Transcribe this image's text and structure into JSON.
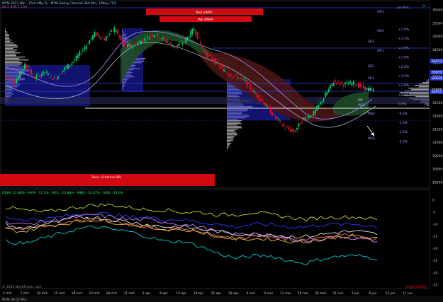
{
  "header": {
    "line1": "MYM 2022 Min - 15minMp % - MYM Swing Channel 360 Min, 1Mkey TFO",
    "line2": "48.2 47N 1 100"
  },
  "top_right_logo": "⟳",
  "brand_bottom_right": "NINJATRADER",
  "copyright": "© 2022 NinjaTrader, LLC",
  "tab_label": "MYM 06-22 Min",
  "colors": {
    "bg": "#000000",
    "up": "#00d26a",
    "down": "#e0132b",
    "red_banner": "#d10a12",
    "blue_level": "#2e3fd9",
    "profile_gray": "#9a9a9a",
    "profile_blue": "#1f22c8",
    "green_fill": "#1d4a24",
    "red_fill": "#4a1414",
    "sine": "#8a7fd8"
  },
  "banners": {
    "red_vwap": "Red VWAP",
    "wk_vwap": "Wk VWAP",
    "poc": "Pocs +Channel BO"
  },
  "level_labels": {
    "top_blue": "Jan POC",
    "mr3": "MR3",
    "mr2": "MR2",
    "mr1": "MR1",
    "sr3": "SR3",
    "sr2": "SR2",
    "sr1": "SR1",
    "pp": "PP",
    "mp": "MP",
    "ws1": "WS1",
    "ws2": "WS2",
    "ws3": "WS3"
  },
  "pct_labels": [
    "+1.0%",
    "+1.5%",
    "+1.5%",
    "+1.0%",
    "+2.0%",
    "+1.5%",
    "+1.0%",
    "+0.5%",
    "0.0%",
    "-0.5%",
    "-1.0%",
    "-1.5%",
    "-2.0%"
  ],
  "price_axis": [
    "36000",
    "35500",
    "35000",
    "34500",
    "34000",
    "33500",
    "33000",
    "32500",
    "32000",
    "31500",
    "31000",
    "30500",
    "30000",
    "29500"
  ],
  "price_tags": [
    {
      "label": "34073",
      "color": "#2e3fd9"
    },
    {
      "label": "33651",
      "color": "#2e3fd9"
    },
    {
      "label": "33424",
      "color": "#2e3fd9"
    },
    {
      "label": "32985",
      "color": "#1a1a1a"
    },
    {
      "label": "32917",
      "color": "#2e3fd9"
    }
  ],
  "indicator": {
    "title": "FSSM: 22.88% · MYM: -11.2% · MES: -15.88% · MNQ: -24.07% · M2K: -17.0%",
    "axis": [
      "0",
      "-5",
      "-10",
      "-15",
      "-20",
      "-25",
      "-30",
      "-35"
    ]
  },
  "time_axis": [
    "2 mrt",
    "7 mrt",
    "10 mrt",
    "15 mrt",
    "18 mrt",
    "23 mrt",
    "28 mrt",
    "31 mrt",
    "5 apr",
    "8 apr",
    "13 apr",
    "19 apr",
    "25 apr",
    "28 apr",
    "4 mei",
    "9 mei",
    "12 mei",
    "18 mei",
    "25 mei",
    "31 mei",
    "3 jun",
    "8 jun",
    "14 jun",
    "17 jun"
  ],
  "chart_data": [
    {
      "type": "line",
      "note_series": "price panel (MYM 15min, close approximated)",
      "ylim": [
        29500,
        36000
      ],
      "series": [
        {
          "values": [
            33500,
            33300,
            33900,
            33450,
            33650,
            33400,
            33800,
            34100,
            34600,
            35100,
            34900,
            35300,
            34600,
            34700,
            34900,
            35100,
            34850,
            34600,
            34800,
            35300,
            34400,
            34100,
            33700,
            33500,
            33350,
            32900,
            32500,
            32000,
            31600,
            31400,
            31900,
            32100,
            32700,
            33300,
            33200,
            33250,
            33050,
            32980
          ]
        }
      ]
    },
    {
      "type": "line",
      "note_series": "lower relative performance panel",
      "ylim": [
        -35,
        0
      ],
      "series": [
        {
          "name": "FSSM",
          "color": "#c8e020",
          "values": [
            -3,
            -4,
            -5,
            -4,
            -3,
            -2,
            -2,
            -3,
            -4,
            -4,
            -5,
            -5,
            -6,
            -6,
            -5,
            -6,
            -7,
            -8,
            -7,
            -7,
            -7,
            -8
          ]
        },
        {
          "name": "MYM",
          "color": "#2a3cff",
          "values": [
            -7,
            -8,
            -8,
            -7,
            -6,
            -5,
            -6,
            -7,
            -7,
            -8,
            -8,
            -9,
            -10,
            -11,
            -10,
            -10,
            -11,
            -11,
            -10,
            -10,
            -10,
            -11
          ]
        },
        {
          "name": "MES",
          "color": "#ff7a7a",
          "values": [
            -11,
            -12,
            -11,
            -10,
            -8,
            -8,
            -9,
            -10,
            -11,
            -12,
            -12,
            -13,
            -15,
            -16,
            -15,
            -15,
            -16,
            -16,
            -15,
            -14,
            -15,
            -16
          ]
        },
        {
          "name": "MNQ",
          "color": "#00d0d0",
          "values": [
            -17,
            -18,
            -16,
            -14,
            -12,
            -11,
            -12,
            -13,
            -15,
            -17,
            -17,
            -19,
            -22,
            -24,
            -23,
            -23,
            -25,
            -26,
            -24,
            -23,
            -23,
            -24
          ]
        },
        {
          "name": "M2K",
          "color": "#c87aff",
          "values": [
            -9,
            -10,
            -9,
            -8,
            -7,
            -6,
            -7,
            -8,
            -8,
            -9,
            -10,
            -11,
            -13,
            -14,
            -14,
            -15,
            -16,
            -17,
            -16,
            -15,
            -16,
            -17
          ]
        },
        {
          "color": "#e6e6e6",
          "values": [
            -10,
            -12,
            -10,
            -9,
            -7,
            -7,
            -8,
            -9,
            -10,
            -11,
            -11,
            -12,
            -13,
            -14,
            -14,
            -14,
            -15,
            -15,
            -14,
            -13,
            -13,
            -14
          ]
        },
        {
          "color": "#f0c020",
          "values": [
            -12,
            -13,
            -11,
            -10,
            -9,
            -8,
            -9,
            -10,
            -11,
            -12,
            -12,
            -13,
            -15,
            -16,
            -16,
            -16,
            -17,
            -17,
            -16,
            -15,
            -15,
            -16
          ]
        }
      ]
    }
  ]
}
